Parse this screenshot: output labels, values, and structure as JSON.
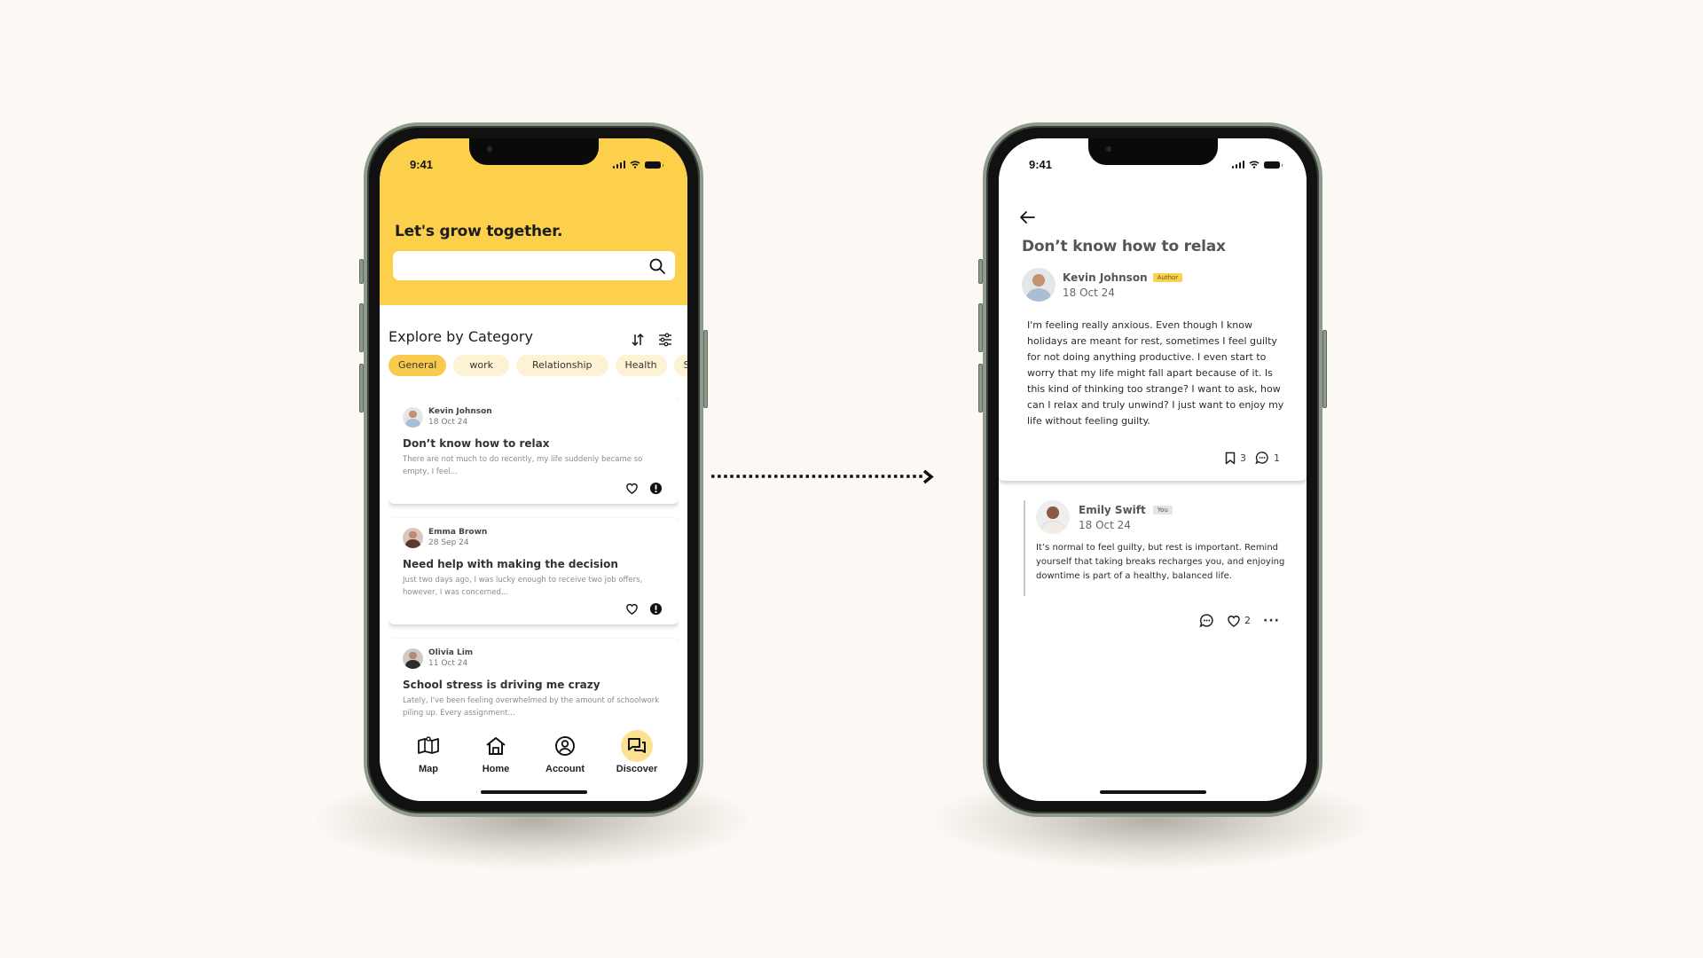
{
  "left_phone": {
    "status_bar": {
      "time": "9:41"
    },
    "header": {
      "greeting": "Let's grow together.",
      "search_placeholder": ""
    },
    "explore": {
      "title": "Explore by Category",
      "sort_icon": "sort-icon",
      "filter_icon": "sliders-icon",
      "categories": [
        {
          "label": "General",
          "active": true
        },
        {
          "label": "work",
          "active": false
        },
        {
          "label": "Relationship",
          "active": false
        },
        {
          "label": "Health",
          "active": false
        },
        {
          "label": "Soci",
          "active": false
        }
      ]
    },
    "posts": [
      {
        "author": "Kevin Johnson",
        "date": "18 Oct 24",
        "title": "Don’t know how to relax",
        "excerpt": "There are not much to do recently, my life suddenly became so empty, I feel...",
        "actions": [
          "heart-icon",
          "alert-icon"
        ]
      },
      {
        "author": "Emma Brown",
        "date": "28 Sep 24",
        "title": "Need help with making the decision",
        "excerpt": "Just two days ago, I was lucky enough to receive two job offers, however, I was concerned...",
        "actions": [
          "heart-icon",
          "alert-icon"
        ]
      },
      {
        "author": "Olivia Lim",
        "date": "11 Oct 24",
        "title": "School stress is driving me crazy",
        "excerpt": "Lately, I've been feeling overwhelmed by the amount of schoolwork piling up. Every assignment...",
        "actions": []
      }
    ],
    "bottom_nav": [
      {
        "label": "Map",
        "icon": "map-icon",
        "active": false
      },
      {
        "label": "Home",
        "icon": "home-icon",
        "active": false
      },
      {
        "label": "Account",
        "icon": "account-icon",
        "active": false
      },
      {
        "label": "Discover",
        "icon": "chat-bubbles-icon",
        "active": true
      }
    ]
  },
  "right_phone": {
    "status_bar": {
      "time": "9:41"
    },
    "post": {
      "title": "Don’t know how to relax",
      "author": "Kevin Johnson",
      "author_badge": "Author",
      "date": "18 Oct 24",
      "body": "I'm feeling really anxious. Even though I know holidays are meant for rest, sometimes I feel guilty for not doing anything productive. I even start to worry that my life might fall apart because of it. Is this kind of thinking too strange? I want to ask, how can I relax and truly unwind? I just want to enjoy my life without feeling guilty.",
      "bookmarks": "3",
      "comments": "1"
    },
    "comment": {
      "author": "Emily Swift",
      "badge": "You",
      "date": "18 Oct 24",
      "text": "It’s normal to feel guilty, but rest is important. Remind yourself that taking breaks recharges you, and enjoying downtime is part of a healthy, balanced life.",
      "likes": "2"
    }
  },
  "colors": {
    "accent_yellow": "#fdd04c",
    "chip_bg": "#fdf2d3",
    "background": "#fcf9f4",
    "phone_frame": "#8e9a8c"
  }
}
